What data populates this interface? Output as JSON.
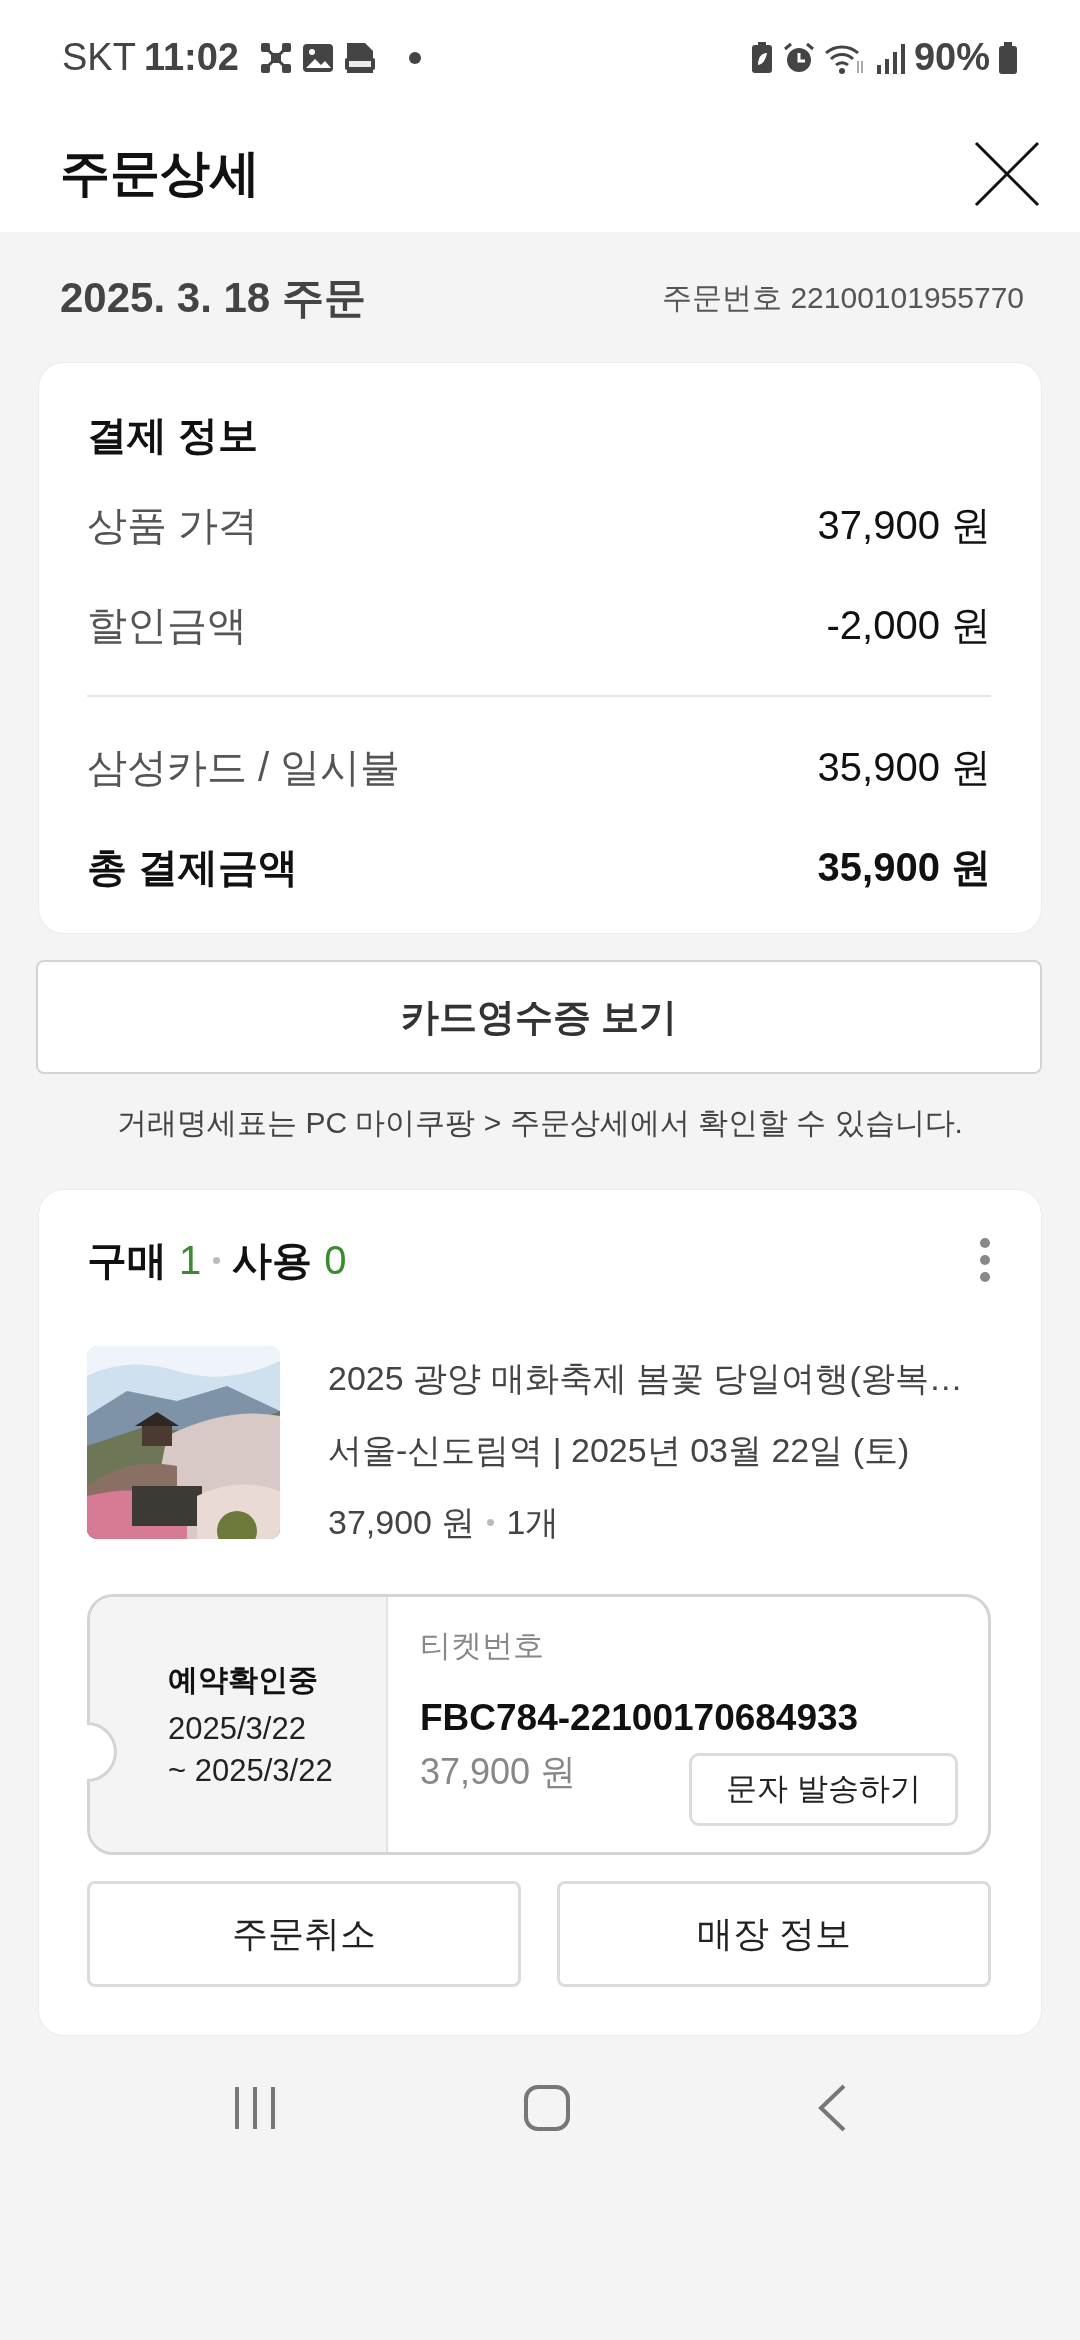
{
  "status_bar": {
    "carrier": "SKT",
    "time": "11:02",
    "battery": "90%"
  },
  "header": {
    "title": "주문상세"
  },
  "order": {
    "date": "2025. 3. 18 주문",
    "order_number": "주문번호 22100101955770"
  },
  "payment": {
    "title": "결제 정보",
    "rows": [
      {
        "kind": "item",
        "label": "상품 가격",
        "value": "37,900 원"
      },
      {
        "kind": "item",
        "label": "할인금액",
        "value": "-2,000 원"
      },
      {
        "kind": "divider"
      },
      {
        "kind": "item",
        "label": "삼성카드 / 일시불",
        "value": "35,900 원"
      },
      {
        "kind": "total",
        "label": "총 결제금액",
        "value": "35,900 원"
      }
    ]
  },
  "receipt_button": "카드영수증 보기",
  "note": "거래명세표는 PC 마이쿠팡 > 주문상세에서 확인할 수 있습니다.",
  "purchase": {
    "bought_label": "구매",
    "bought_count": "1",
    "used_label": "사용",
    "used_count": "0"
  },
  "product": {
    "name": "2025 광양 매화축제 봄꽃 당일여행(왕복…",
    "detail": "서울-신도림역 | 2025년 03월 22일 (토)",
    "price": "37,900 원",
    "quantity": "1개"
  },
  "ticket": {
    "status": "예약확인중",
    "date_from": "2025/3/22",
    "date_to": "~ 2025/3/22",
    "label": "티켓번호",
    "number": "FBC784-22100170684933",
    "price": "37,900 원",
    "sms_button": "문자 발송하기"
  },
  "buttons": [
    "주문취소",
    "매장 정보"
  ]
}
